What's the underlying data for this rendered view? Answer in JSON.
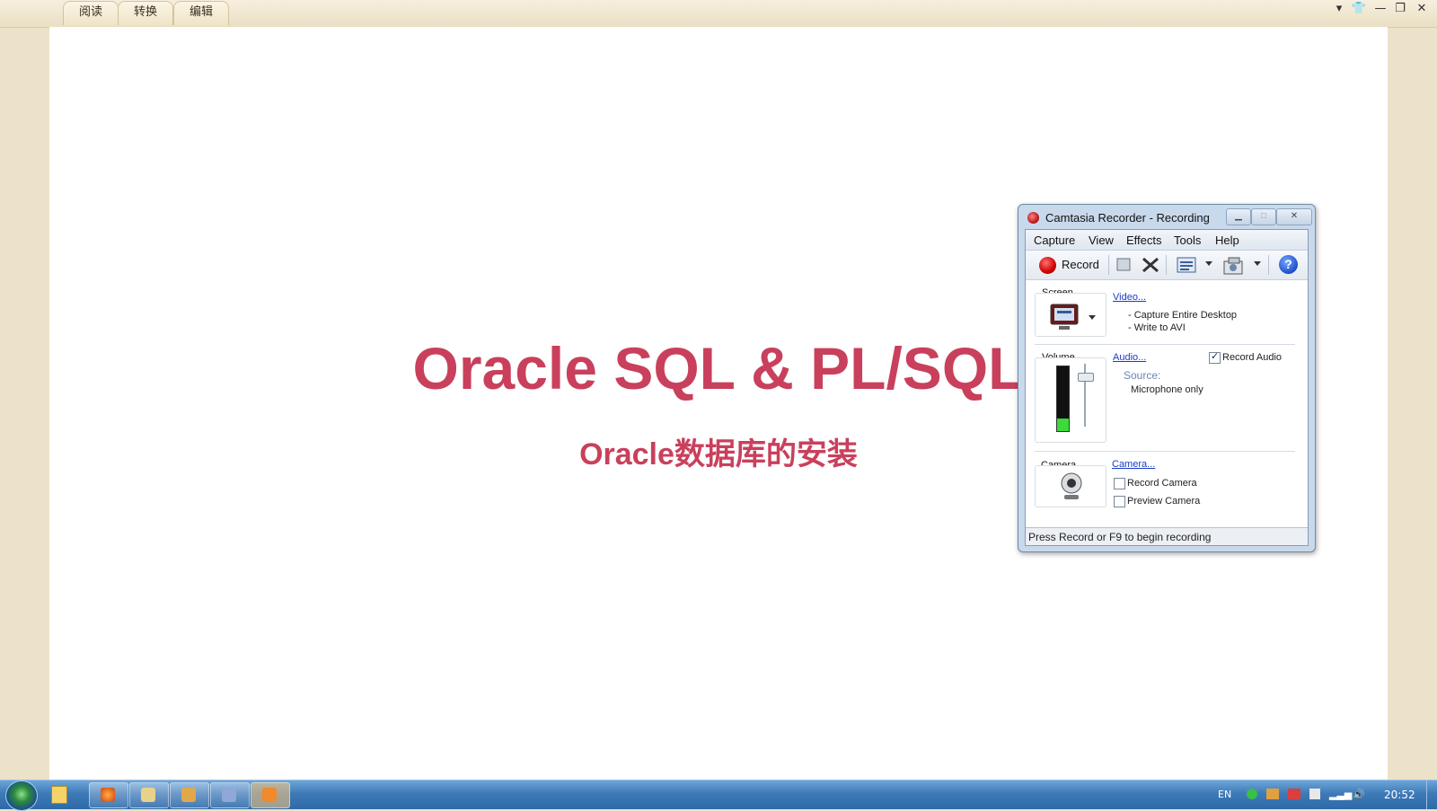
{
  "reader": {
    "tabs": [
      "阅读",
      "转换",
      "编辑"
    ]
  },
  "slide": {
    "title": "Oracle SQL & PL/SQL",
    "subtitle": "Oracle数据库的安装",
    "accent_color": "#c9405c"
  },
  "recorder": {
    "title": "Camtasia Recorder - Recording",
    "menu": [
      "Capture",
      "View",
      "Effects",
      "Tools",
      "Help"
    ],
    "toolbar": {
      "record_label": "Record",
      "icons": [
        "stop-icon",
        "delete-icon",
        "screen-region-icon",
        "camera-settings-icon",
        "help-icon"
      ]
    },
    "screen": {
      "label": "Screen",
      "link": "Video...",
      "details": [
        "- Capture Entire Desktop",
        "- Write to AVI"
      ]
    },
    "volume": {
      "label": "Volume",
      "link": "Audio...",
      "record_audio_label": "Record Audio",
      "record_audio_checked": true,
      "source_label": "Source:",
      "source_value": "Microphone only",
      "level": 0.2
    },
    "camera": {
      "label": "Camera",
      "link": "Camera...",
      "record_camera_label": "Record Camera",
      "record_camera_checked": false,
      "preview_camera_label": "Preview Camera",
      "preview_camera_checked": false
    },
    "status": "Press Record or F9 to begin recording"
  },
  "taskbar": {
    "language": "EN",
    "clock": "20:52"
  }
}
